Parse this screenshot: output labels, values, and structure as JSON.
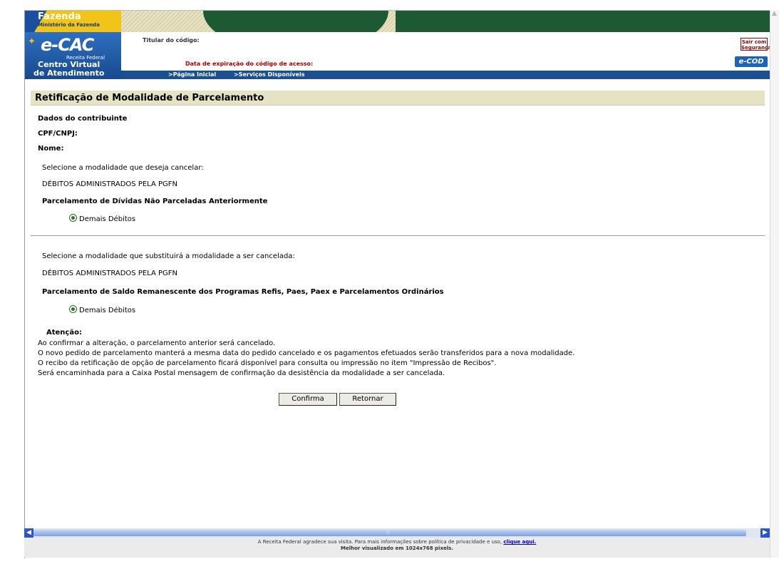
{
  "header": {
    "fazenda_title": "Fazenda",
    "fazenda_subtitle": "Ministério da Fazenda",
    "ecac_logo": "e-CAC",
    "receita": "Receita Federal",
    "centro_virtual": "Centro Virtual",
    "de_atendimento": "de Atendimento",
    "titular_label": "Titular do código:",
    "expiracao_label": "Data de expiração do código de acesso:",
    "sair_label": "Sair com Segurança",
    "ecod_label": "e-COD"
  },
  "nav": {
    "pagina_inicial": ">Página Inicial",
    "servicos": ">Serviços Disponíveis"
  },
  "page": {
    "title": "Retificação de Modalidade de Parcelamento",
    "dados": "Dados do contribuinte",
    "cpf": "CPF/CNPJ:",
    "nome": "Nome:"
  },
  "cancel_section": {
    "prompt": "Selecione a modalidade que deseja cancelar:",
    "group": "DÉBITOS ADMINISTRADOS PELA PGFN",
    "heading": "Parcelamento de Dívidas Não Parceladas Anteriormente",
    "option": "Demais Débitos"
  },
  "replace_section": {
    "prompt": "Selecione a modalidade que substituirá a modalidade a ser cancelada:",
    "group": "DÉBITOS ADMINISTRADOS PELA PGFN",
    "heading": "Parcelamento de Saldo Remanescente dos Programas Refis, Paes, Paex e Parcelamentos Ordinários",
    "option": "Demais Débitos"
  },
  "attention": {
    "title": "Atenção:",
    "lines": [
      "Ao confirmar a alteração, o parcelamento anterior será cancelado.",
      "O novo pedido de parcelamento manterá a mesma data do pedido cancelado e os pagamentos efetuados serão transferidos para a nova modalidade.",
      "O recibo da retificação de opção de parcelamento ficará disponível para consulta ou impressão no item \"Impressão de Recibos\".",
      "Será encaminhada para a Caixa Postal mensagem de confirmação da desistência da modalidade a ser cancelada."
    ]
  },
  "buttons": {
    "confirma": "Confirma",
    "retornar": "Retornar"
  },
  "footer": {
    "line1": "A Receita Federal agradece sua visita. Para mais informações sobre política de privacidade e uso,",
    "link": "clique aqui.",
    "line2": "Melhor visualizado em 1024x768 pixels."
  }
}
